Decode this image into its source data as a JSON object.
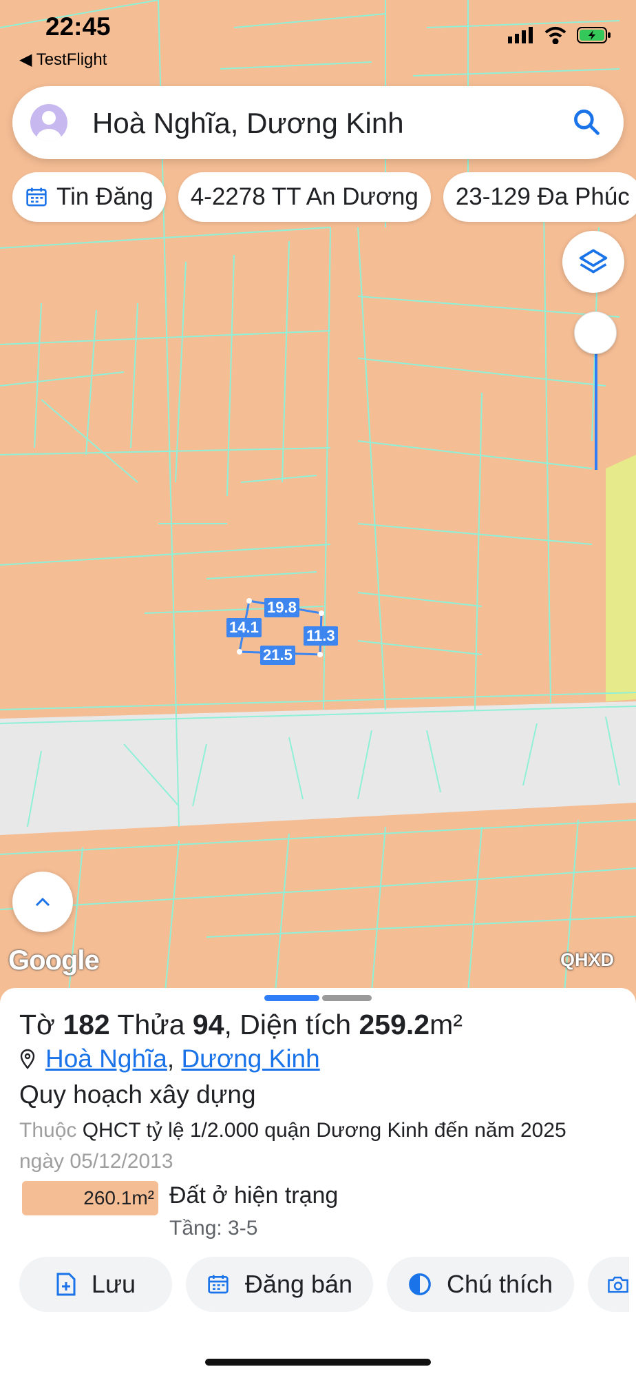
{
  "status_bar": {
    "time": "22:45",
    "back_app": "TestFlight"
  },
  "search": {
    "value": "Hoà Nghĩa, Dương Kinh"
  },
  "chips": [
    {
      "label": "Tin Đăng",
      "icon": "calendar-icon"
    },
    {
      "label": "4-2278 TT An Dương"
    },
    {
      "label": "23-129 Đa Phúc"
    }
  ],
  "map": {
    "dimensions": {
      "top": "19.8",
      "left": "14.1",
      "right": "11.3",
      "bottom": "21.5"
    },
    "google_label": "Google",
    "layer_label": "QHXD"
  },
  "sheet": {
    "title_prefix": "Tờ ",
    "sheet_no": "182",
    "title_mid": " Thửa ",
    "parcel_no": "94",
    "title_area_label": ", Diện tích ",
    "area": "259.2",
    "area_unit": "m²",
    "ward": "Hoà Nghĩa",
    "district": "Dương Kinh",
    "planning_title": "Quy hoạch xây dựng",
    "desc_prefix": "Thuộc ",
    "desc_main": "QHCT tỷ lệ 1/2.000 quận Dương Kinh đến năm 2025",
    "desc_date_label": " ngày ",
    "desc_date": "05/12/2013",
    "zone_area": "260.1m²",
    "zone_type": "Đất ở hiện trạng",
    "zone_floors": "Tầng: 3-5"
  },
  "actions": [
    {
      "label": "Lưu",
      "icon": "file-add-icon"
    },
    {
      "label": "Đăng bán",
      "icon": "calendar-icon"
    },
    {
      "label": "Chú thích",
      "icon": "contrast-icon"
    }
  ],
  "colors": {
    "land": "#f5bd94",
    "road": "#e8e8e8",
    "lines": "#8ff0d8",
    "accent": "#2f7ef7",
    "green_zone": "#e6ea8a"
  }
}
